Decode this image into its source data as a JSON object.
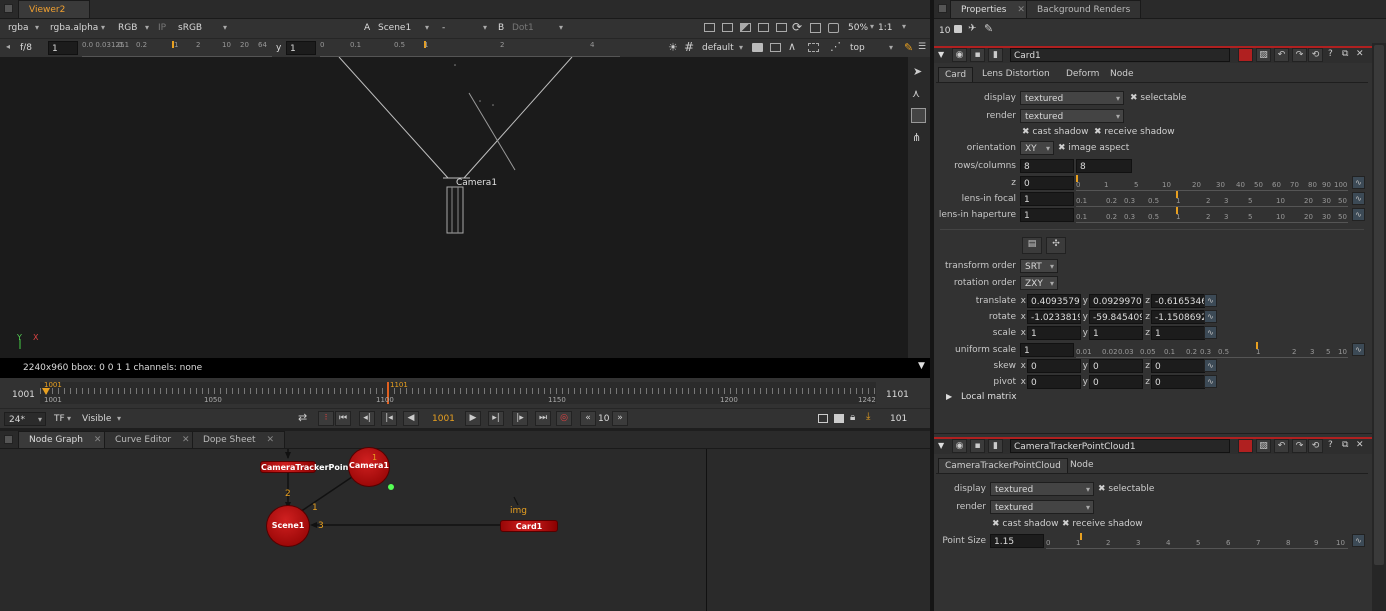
{
  "viewer": {
    "tab": "Viewer2",
    "channels": "rgba",
    "alpha": "rgba.alpha",
    "display": "RGB",
    "ip": "IP",
    "colorspace": "sRGB",
    "a_label": "A",
    "a_input": "Scene1",
    "a_mode": "-",
    "b_label": "B",
    "b_input": "Dot1",
    "zoom": "50%",
    "ratio": "1:1",
    "fstop": "f/8",
    "gain": "1",
    "gamma_label": "y",
    "gamma": "1",
    "gain_ticks": [
      "0.0 0.03125",
      "0.1",
      "0.2",
      "1",
      "2",
      "10",
      "20",
      "64"
    ],
    "gamma_ticks": [
      "0",
      "0.1",
      "0.5",
      "1",
      "2",
      "4"
    ],
    "camera_mode": "default",
    "view": "top",
    "camera_label": "Camera1",
    "axis_y": "Y",
    "axis_x": "X",
    "info": "2240x960  bbox: 0 0 1 1 channels: none"
  },
  "timeline": {
    "start": "1001",
    "end": "1101",
    "in_marker": "1001",
    "current_marker": "1101",
    "ticks": [
      "1001",
      "1050",
      "1100",
      "1150",
      "1200",
      "1242"
    ],
    "fps": "24*",
    "tf": "TF",
    "visible": "Visible",
    "current_frame": "1001",
    "step": "10",
    "frame_total": "101"
  },
  "bottom_tabs": [
    "Node Graph",
    "Curve Editor",
    "Dope Sheet"
  ],
  "nodes": {
    "pointcloud": "CameraTrackerPointCloud1",
    "camera": "Camera1",
    "scene": "Scene1",
    "card": "Card1",
    "img": "img",
    "camera_num": "1",
    "edge_2": "2",
    "edge_1": "1",
    "edge_3": "3"
  },
  "properties": {
    "tabs": [
      "Properties",
      "Background Renders"
    ],
    "count": "10",
    "card": {
      "name": "Card1",
      "tabs": [
        "Card",
        "Lens Distortion",
        "Deform",
        "Node"
      ],
      "display_label": "display",
      "display": "textured",
      "selectable": "selectable",
      "render_label": "render",
      "render": "textured",
      "cast_shadow": "cast shadow",
      "receive_shadow": "receive shadow",
      "orientation_label": "orientation",
      "orientation": "XY",
      "image_aspect": "image aspect",
      "rows_label": "rows/columns",
      "rows": "8",
      "columns": "8",
      "z_label": "z",
      "z": "0",
      "z_ticks": [
        "0",
        "1",
        "5",
        "10",
        "20",
        "30",
        "40",
        "50",
        "60",
        "70",
        "80",
        "90",
        "100"
      ],
      "lens_focal_label": "lens-in focal",
      "lens_focal": "1",
      "lens_hap_label": "lens-in haperture",
      "lens_hap": "1",
      "lens_ticks": [
        "0.1",
        "0.2",
        "0.3",
        "0.5",
        "1",
        "2",
        "3",
        "5",
        "10",
        "20",
        "30",
        "50"
      ],
      "transform_order_label": "transform order",
      "transform_order": "SRT",
      "rotation_order_label": "rotation order",
      "rotation_order": "ZXY",
      "translate_label": "translate",
      "translate": {
        "x": "0.40935796",
        "y": "0.09299703",
        "z": "-0.61653465"
      },
      "rotate_label": "rotate",
      "rotate": {
        "x": "-1.02338195",
        "y": "-59.8454093",
        "z": "-1.15086925"
      },
      "scale_label": "scale",
      "scale": {
        "x": "1",
        "y": "1",
        "z": "1"
      },
      "uniform_label": "uniform scale",
      "uniform": "1",
      "uniform_ticks": [
        "0.01",
        "0.02",
        "0.03",
        "0.05",
        "0.1",
        "0.2",
        "0.3",
        "0.5",
        "1",
        "2",
        "3",
        "5",
        "10"
      ],
      "skew_label": "skew",
      "skew": {
        "x": "0",
        "y": "0",
        "z": "0"
      },
      "pivot_label": "pivot",
      "pivot": {
        "x": "0",
        "y": "0",
        "z": "0"
      },
      "local_matrix": "Local matrix",
      "x": "x",
      "y": "y",
      "z_axis": "z"
    },
    "pointcloud": {
      "name": "CameraTrackerPointCloud1",
      "tabs": [
        "CameraTrackerPointCloud",
        "Node"
      ],
      "display_label": "display",
      "display": "textured",
      "selectable": "selectable",
      "render_label": "render",
      "render": "textured",
      "cast_shadow": "cast shadow",
      "receive_shadow": "receive shadow",
      "point_size_label": "Point Size",
      "point_size": "1.15",
      "ps_ticks": [
        "0",
        "1",
        "2",
        "3",
        "4",
        "5",
        "6",
        "7",
        "8",
        "9",
        "10"
      ]
    }
  },
  "icons": {
    "close": "close-icon",
    "check": "✖",
    "anim": "animation-curve-icon"
  }
}
